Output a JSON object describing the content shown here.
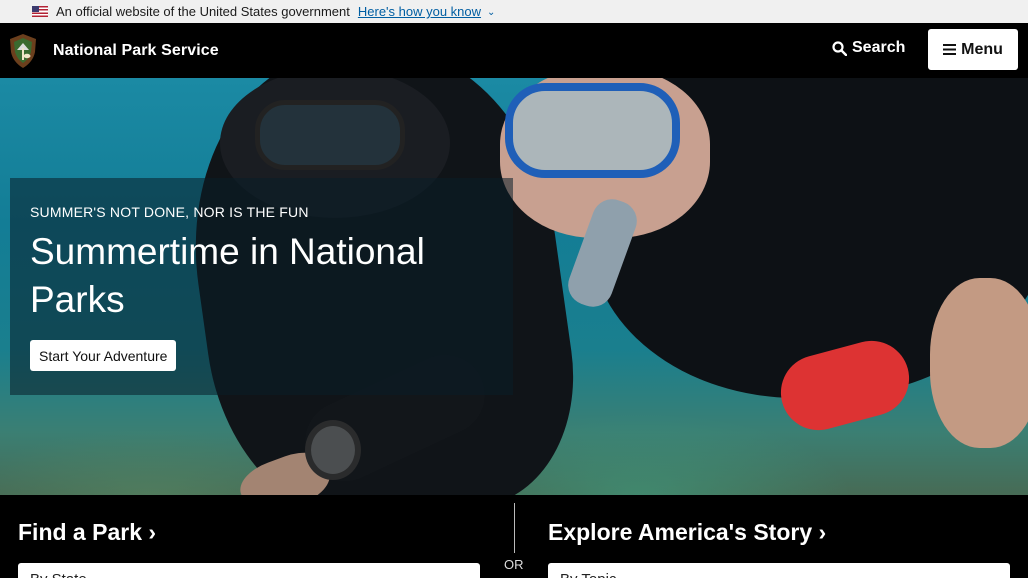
{
  "gov_banner": {
    "text": "An official website of the United States government",
    "link": "Here's how you know"
  },
  "header": {
    "site_name": "National Park Service",
    "search_label": "Search",
    "menu_label": "Menu"
  },
  "hero": {
    "eyebrow": "SUMMER'S NOT DONE, NOR IS THE FUN",
    "title": "Summertime in National Parks",
    "cta_label": "Start Your Adventure"
  },
  "find_park": {
    "title": "Find a Park",
    "select_value": "By State"
  },
  "divider_text": "OR",
  "explore": {
    "title": "Explore America's Story",
    "select_value": "By Topic"
  },
  "colors": {
    "gov_link": "#005ea2",
    "header_bg": "#000000",
    "banner_bg": "#f0f0f0"
  }
}
